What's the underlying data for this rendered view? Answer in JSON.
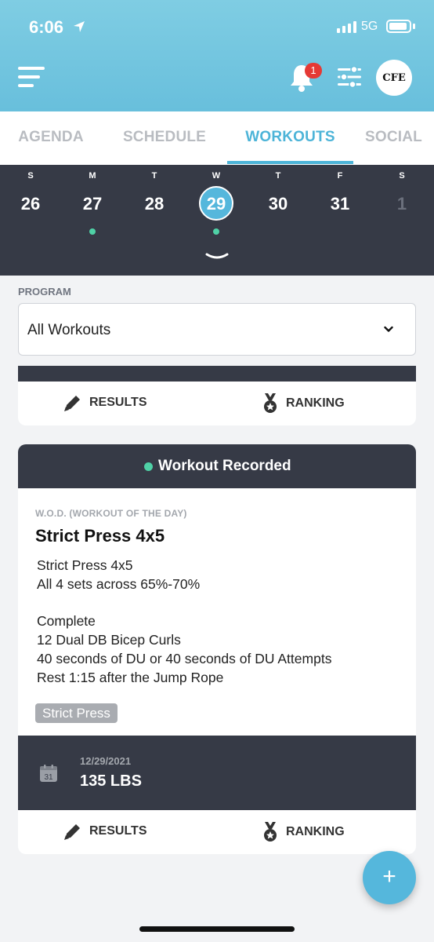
{
  "status_bar": {
    "time": "6:06",
    "network": "5G"
  },
  "header": {
    "notification_count": "1",
    "avatar_text": "CFE"
  },
  "tabs": [
    {
      "label": "AGENDA"
    },
    {
      "label": "SCHEDULE"
    },
    {
      "label": "WORKOUTS",
      "active": true
    },
    {
      "label": "SOCIAL"
    }
  ],
  "calendar": {
    "days": [
      {
        "dow": "S",
        "num": "26"
      },
      {
        "dow": "M",
        "num": "27",
        "has_workout": true
      },
      {
        "dow": "T",
        "num": "28"
      },
      {
        "dow": "W",
        "num": "29",
        "selected": true,
        "has_workout": true
      },
      {
        "dow": "T",
        "num": "30"
      },
      {
        "dow": "F",
        "num": "31"
      },
      {
        "dow": "S",
        "num": "1",
        "muted": true
      }
    ]
  },
  "program": {
    "label": "PROGRAM",
    "selected": "All Workouts"
  },
  "actions": {
    "results": "RESULTS",
    "ranking": "RANKING"
  },
  "workout": {
    "status": "Workout Recorded",
    "category": "W.O.D. (WORKOUT OF THE DAY)",
    "title": "Strict Press 4x5",
    "lines": [
      "Strict Press 4x5",
      "All 4 sets across 65%-70%",
      "Complete",
      "12 Dual DB Bicep Curls",
      "40 seconds of DU or 40 seconds of DU Attempts",
      "Rest 1:15 after the Jump Rope"
    ],
    "tag": "Strict Press",
    "result": {
      "date": "12/29/2021",
      "value": "135 LBS",
      "calendar_day": "31"
    }
  },
  "fab_label": "+",
  "colors": {
    "accent": "#4db4d8",
    "dark": "#363a46",
    "recorded": "#4fd1a6",
    "badge": "#e53935"
  }
}
